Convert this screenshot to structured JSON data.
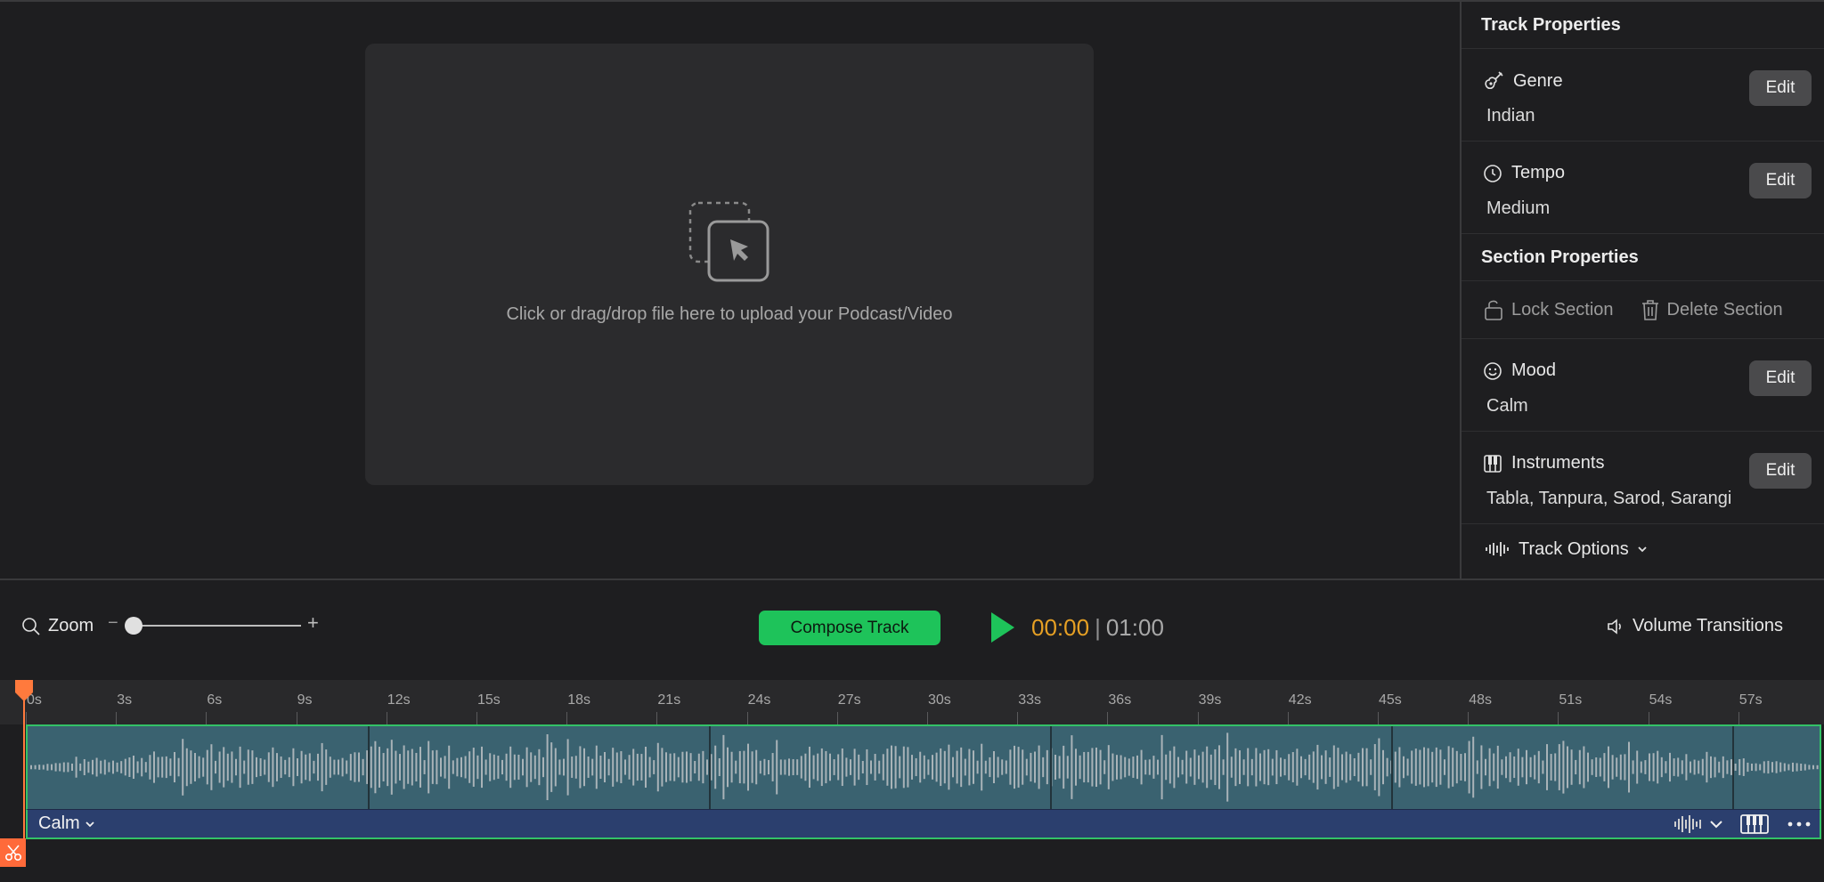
{
  "upload": {
    "prompt": "Click or drag/drop file here to upload your Podcast/Video"
  },
  "track_properties": {
    "heading": "Track Properties",
    "genre": {
      "label": "Genre",
      "value": "Indian",
      "icon": "guitar-icon"
    },
    "tempo": {
      "label": "Tempo",
      "value": "Medium",
      "icon": "clock-icon"
    },
    "edit_label": "Edit"
  },
  "section_properties": {
    "heading": "Section Properties",
    "lock_label": "Lock Section",
    "delete_label": "Delete Section",
    "mood": {
      "label": "Mood",
      "value": "Calm",
      "icon": "smiley-icon"
    },
    "instruments": {
      "label": "Instruments",
      "value": "Tabla, Tanpura, Sarod, Sarangi",
      "icon": "piano-keys-icon"
    }
  },
  "track_options": {
    "label": "Track Options"
  },
  "transport": {
    "zoom_label": "Zoom",
    "zoom_minus": "−",
    "zoom_plus": "+",
    "zoom_level": 0.0,
    "compose_label": "Compose Track",
    "current_time": "00:00",
    "separator": "|",
    "total_time": "01:00",
    "volume_label": "Volume Transitions"
  },
  "timeline": {
    "ticks": [
      "0s",
      "3s",
      "6s",
      "9s",
      "12s",
      "15s",
      "18s",
      "21s",
      "24s",
      "27s",
      "30s",
      "33s",
      "36s",
      "39s",
      "42s",
      "45s",
      "48s",
      "51s",
      "54s",
      "57s"
    ],
    "section_label": "Calm"
  },
  "colors": {
    "accent_green": "#1ec35a",
    "time_orange": "#e6a024",
    "playhead": "#ff7a3d",
    "clip_bg": "#3a6270",
    "section_bar": "#2b3f6e"
  }
}
